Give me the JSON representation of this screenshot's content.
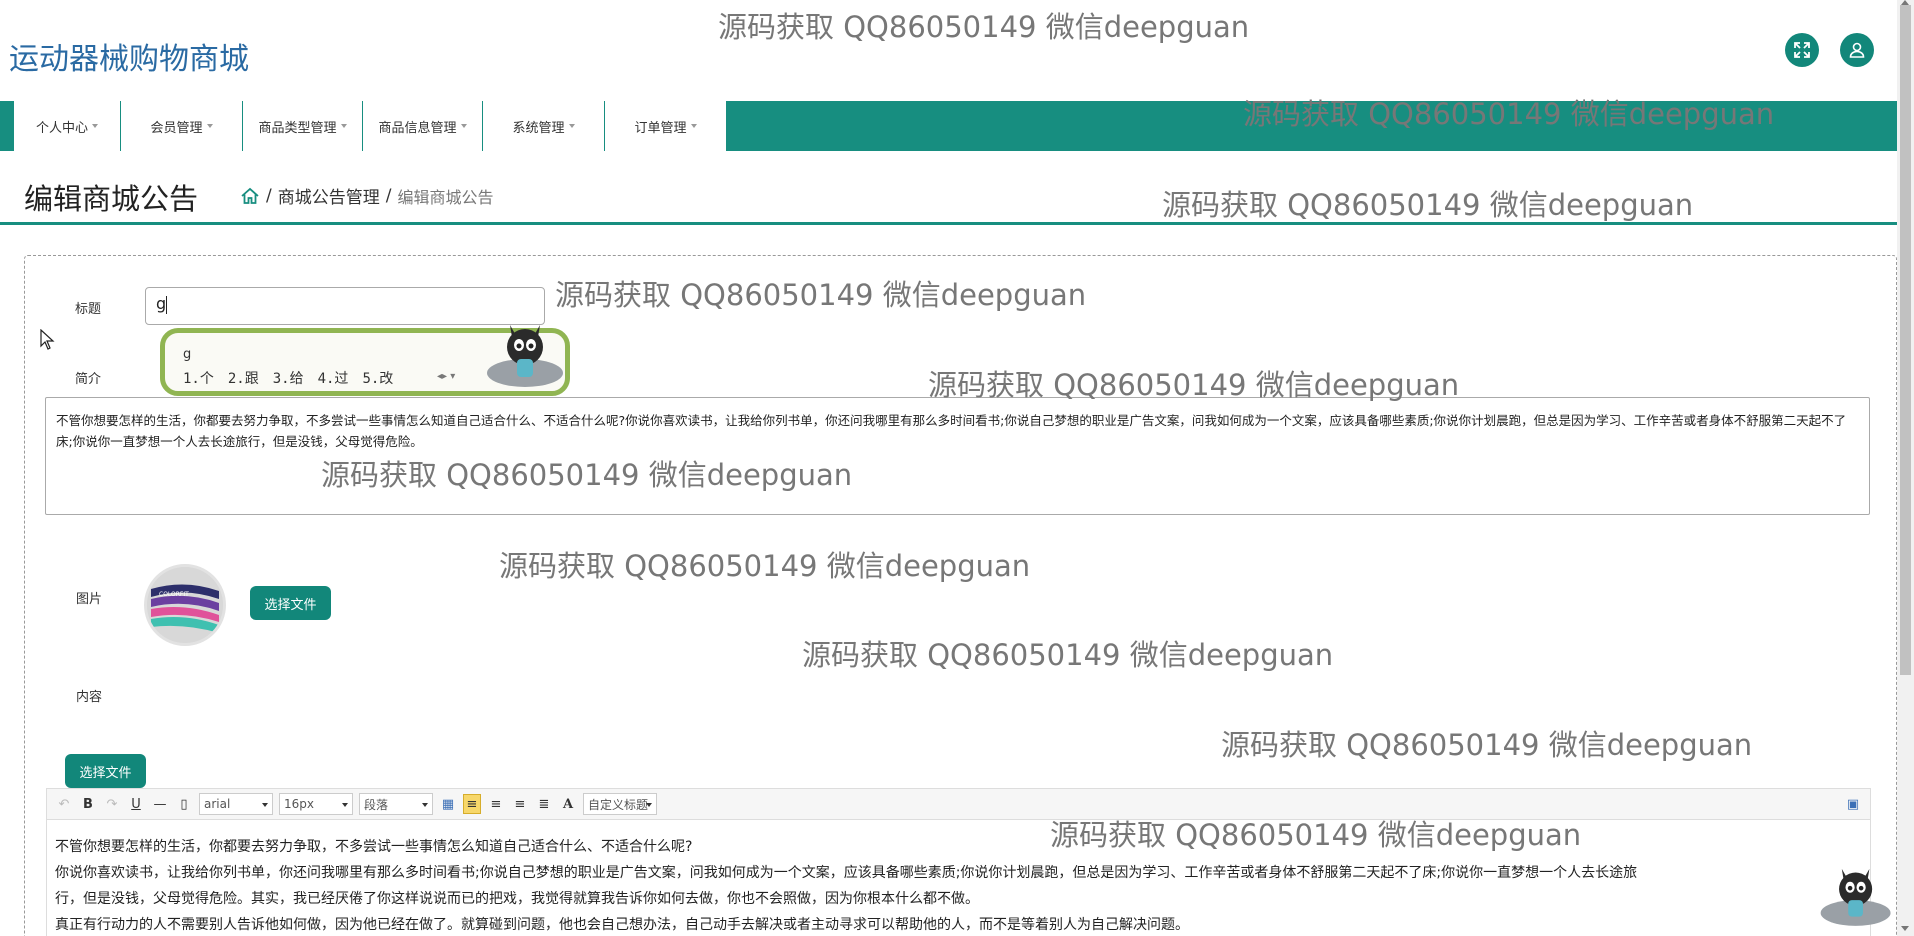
{
  "header": {
    "site_title": "运动器械购物商城",
    "fullscreen_icon": "expand-icon",
    "user_icon": "user-icon"
  },
  "nav": {
    "items": [
      {
        "label": "个人中心"
      },
      {
        "label": "会员管理"
      },
      {
        "label": "商品类型管理"
      },
      {
        "label": "商品信息管理"
      },
      {
        "label": "系统管理"
      },
      {
        "label": "订单管理"
      }
    ]
  },
  "page": {
    "title": "编辑商城公告",
    "breadcrumb": {
      "home_icon": "home-icon",
      "sep": "/",
      "parent": "商城公告管理",
      "current": "编辑商城公告"
    }
  },
  "form": {
    "title_label": "标题",
    "title_value": "g",
    "intro_label": "简介",
    "intro_value": "不管你想要怎样的生活，你都要去努力争取，不多尝试一些事情怎么知道自己适合什么、不适合什么呢?你说你喜欢读书，让我给你列书单，你还问我哪里有那么多时间看书;你说自己梦想的职业是广告文案，问我如何成为一个文案，应该具备哪些素质;你说你计划晨跑，但总是因为学习、工作辛苦或者身体不舒服第二天起不了床;你说你一直梦想一个人去长途旅行，但是没钱，父母觉得危险。",
    "image_label": "图片",
    "choose_file_label": "选择文件",
    "content_label": "内容",
    "content_choose_file_label": "选择文件"
  },
  "editor": {
    "font_family": "arial",
    "font_size": "16px",
    "paragraph": "段落",
    "custom_heading": "自定义标题",
    "font_color_label": "A",
    "bold": "B",
    "italic": "I",
    "underline": "U",
    "hr": "—",
    "paragraphs": [
      "不管你想要怎样的生活，你都要去努力争取，不多尝试一些事情怎么知道自己适合什么、不适合什么呢?",
      "你说你喜欢读书，让我给你列书单，你还问我哪里有那么多时间看书;你说自己梦想的职业是广告文案，问我如何成为一个文案，应该具备哪些素质;你说你计划晨跑，但总是因为学习、工作辛苦或者身体不舒服第二天起不了床;你说你一直梦想一个人去长途旅",
      "行，但是没钱，父母觉得危险。其实，我已经厌倦了你这样说说而已的把戏，我觉得就算我告诉你如何去做，你也不会照做，因为你根本什么都不做。",
      "真正有行动力的人不需要别人告诉他如何做，因为他已经在做了。就算碰到问题，他也会自己想办法，自己动手去解决或者主动寻求可以帮助他的人，而不是等着别人为自己解决问题。"
    ]
  },
  "ime": {
    "pinyin": "g",
    "candidates": [
      "1.个",
      "2.跟",
      "3.给",
      "4.过",
      "5.改"
    ]
  },
  "watermark": "源码获取 QQ86050149 微信deepguan",
  "colors": {
    "accent": "#178e80",
    "button": "#12877a",
    "title_blue": "#2a6aa3"
  }
}
